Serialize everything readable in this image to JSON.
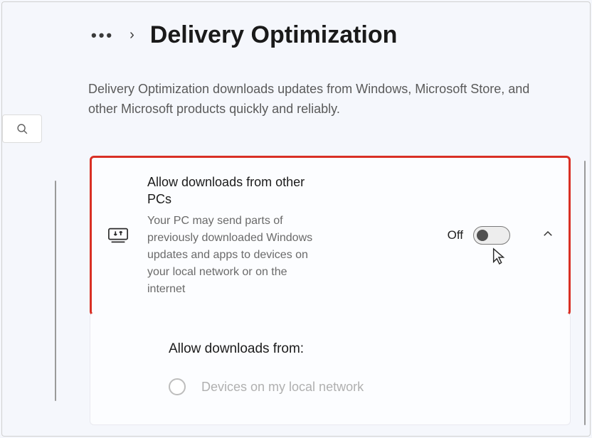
{
  "breadcrumb": {
    "title": "Delivery Optimization"
  },
  "description": "Delivery Optimization downloads updates from Windows, Microsoft Store, and other Microsoft products quickly and reliably.",
  "card": {
    "title": "Allow downloads from other PCs",
    "subtitle": "Your PC may send parts of previously downloaded Windows updates and apps to devices on your local network or on the internet",
    "toggle_state": "Off"
  },
  "subsection": {
    "title": "Allow downloads from:",
    "option1": "Devices on my local network"
  }
}
